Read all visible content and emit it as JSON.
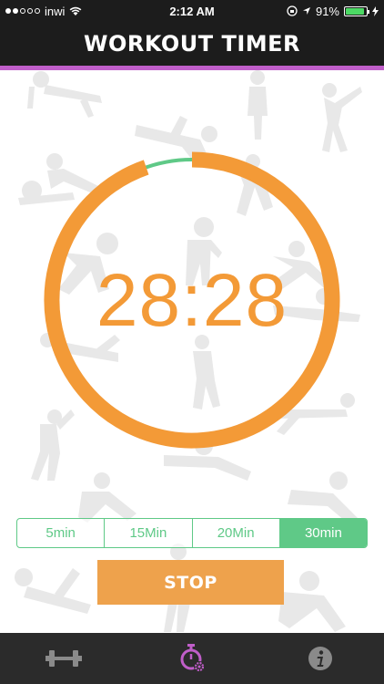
{
  "status_bar": {
    "carrier": "inwi",
    "time": "2:12 AM",
    "battery": "91%",
    "battery_level": 0.91
  },
  "header": {
    "title": "WORKOUT TIMER"
  },
  "timer": {
    "display": "28:28",
    "progress_remaining": 0.947
  },
  "durations": {
    "options": [
      "5min",
      "15Min",
      "20Min",
      "30min"
    ],
    "selected": "30min"
  },
  "actions": {
    "stop_label": "STOP"
  },
  "tab_bar": {
    "tabs": [
      {
        "icon": "dumbbell-icon"
      },
      {
        "icon": "stopwatch-settings-icon"
      },
      {
        "icon": "info-icon"
      }
    ]
  },
  "colors": {
    "accent_orange": "#f39a37",
    "accent_green": "#5fc987",
    "accent_purple": "#c05ec9",
    "bar_dark": "#1c1c1c"
  }
}
